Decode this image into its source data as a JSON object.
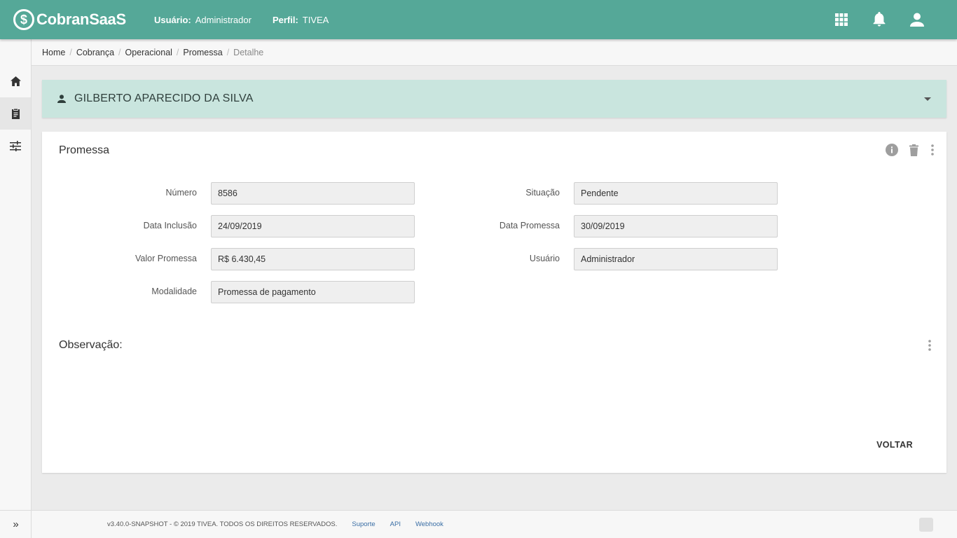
{
  "header": {
    "logo_text": "CobranSaaS",
    "user_label": "Usuário:",
    "user_value": "Administrador",
    "profile_label": "Perfil:",
    "profile_value": "TIVEA"
  },
  "breadcrumb": [
    "Home",
    "Cobrança",
    "Operacional",
    "Promessa",
    "Detalhe"
  ],
  "person": {
    "name": "GILBERTO APARECIDO DA SILVA"
  },
  "card": {
    "title": "Promessa",
    "fields": {
      "numero": {
        "label": "Número",
        "value": "8586"
      },
      "data_inclusao": {
        "label": "Data Inclusão",
        "value": "24/09/2019"
      },
      "valor_promessa": {
        "label": "Valor Promessa",
        "value": "R$ 6.430,45"
      },
      "modalidade": {
        "label": "Modalidade",
        "value": "Promessa de pagamento"
      },
      "situacao": {
        "label": "Situação",
        "value": "Pendente"
      },
      "data_promessa": {
        "label": "Data Promessa",
        "value": "30/09/2019"
      },
      "usuario": {
        "label": "Usuário",
        "value": "Administrador"
      }
    },
    "observacao_title": "Observação:",
    "voltar_label": "VOLTAR"
  },
  "footer": {
    "version": "v3.40.0-SNAPSHOT - © 2019 TIVEA. TODOS OS DIREITOS RESERVADOS.",
    "links": [
      "Suporte",
      "API",
      "Webhook"
    ]
  },
  "icons": {
    "logo": "dollar-coin-icon",
    "apps": "apps-grid-icon",
    "notifications": "bell-icon",
    "account": "person-icon",
    "home": "home-icon",
    "clipboard": "clipboard-icon",
    "settings": "sliders-icon",
    "expand": "double-chevron-right-icon",
    "info": "info-icon",
    "delete": "trash-icon",
    "more": "more-vert-icon"
  },
  "colors": {
    "primary": "#55a898",
    "person_bg": "#c9e5de"
  }
}
